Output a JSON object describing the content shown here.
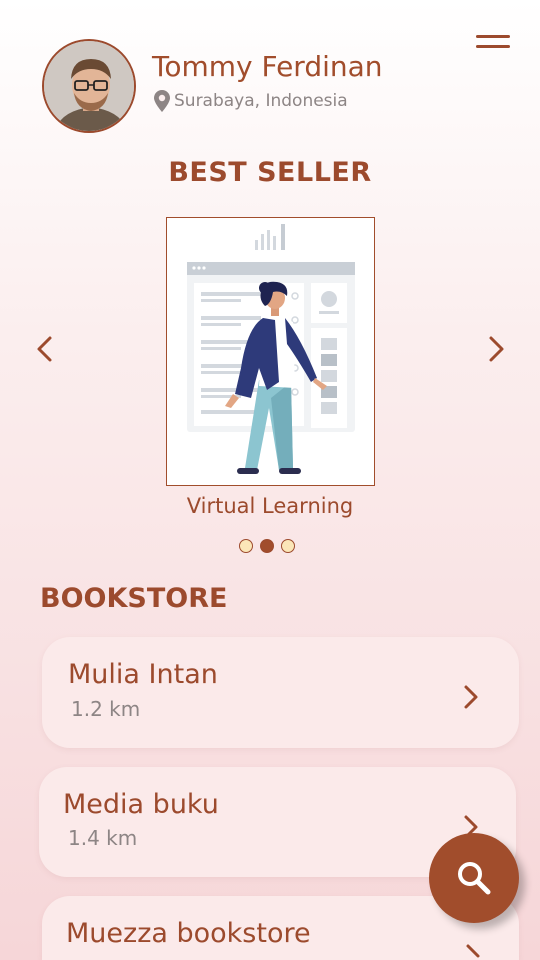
{
  "profile": {
    "name": "Tommy Ferdinan",
    "location": "Surabaya, Indonesia"
  },
  "best_seller": {
    "title": "BEST SELLER",
    "current_item": "Virtual Learning",
    "dots": 3,
    "active_dot": 2
  },
  "bookstore": {
    "title": "BOOKSTORE",
    "items": [
      {
        "name": "Mulia Intan",
        "distance": "1.2 km"
      },
      {
        "name": "Media buku",
        "distance": "1.4 km"
      },
      {
        "name": "Muezza bookstore",
        "distance": ""
      }
    ]
  },
  "icons": {
    "menu": "hamburger-menu-icon",
    "location": "location-pin-icon",
    "prev": "chevron-left-icon",
    "next": "chevron-right-icon",
    "search": "search-icon"
  },
  "colors": {
    "accent": "#a14d2c",
    "background_top": "#ffffff",
    "background_bottom": "#f6d6d8",
    "card": "#fbeaea"
  }
}
